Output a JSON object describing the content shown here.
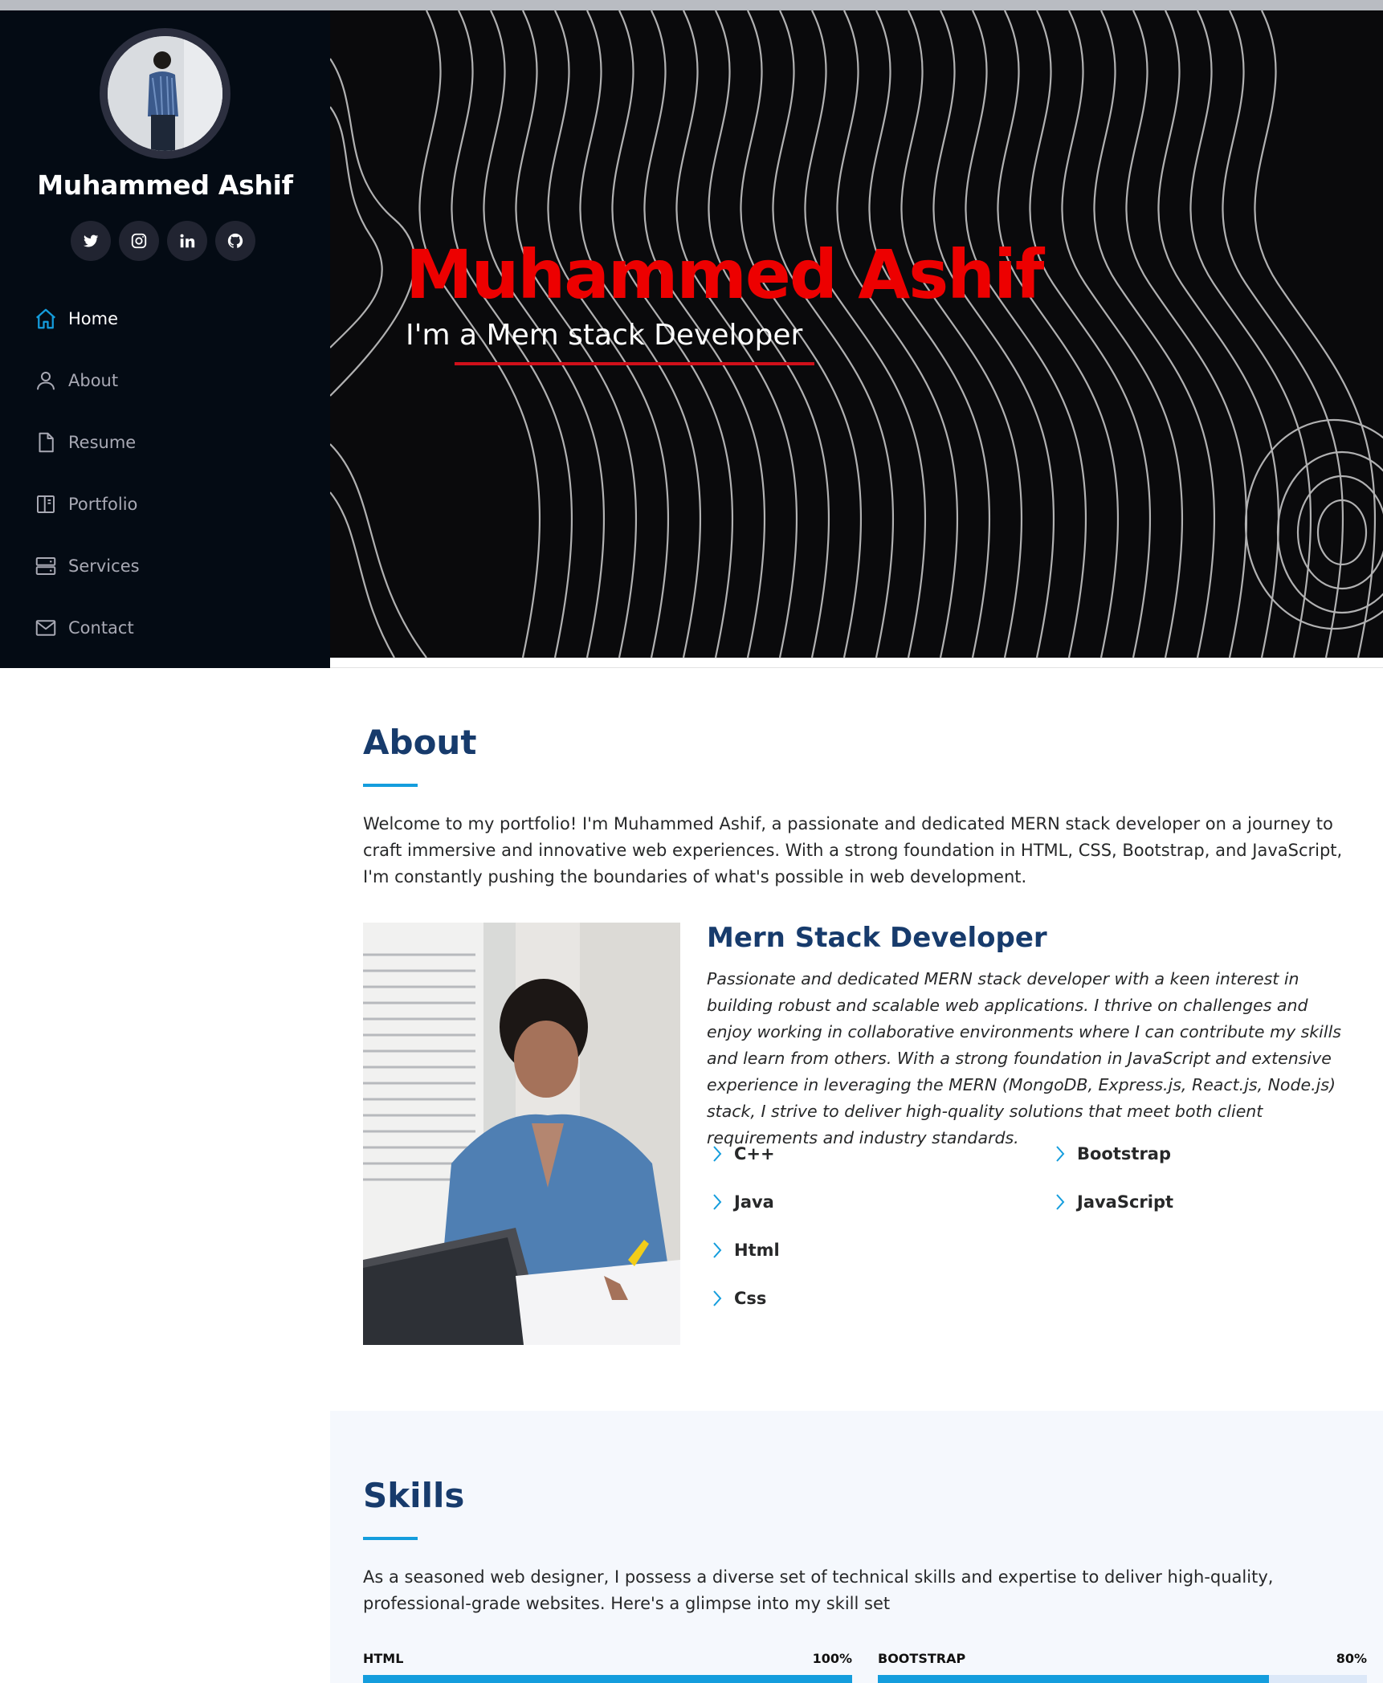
{
  "sidebar": {
    "name": "Muhammed Ashif",
    "social": [
      "twitter-icon",
      "instagram-icon",
      "linkedin-icon",
      "github-icon"
    ],
    "nav": [
      {
        "label": "Home",
        "icon": "home-icon",
        "active": true
      },
      {
        "label": "About",
        "icon": "user-icon"
      },
      {
        "label": "Resume",
        "icon": "file-icon"
      },
      {
        "label": "Portfolio",
        "icon": "book-icon"
      },
      {
        "label": "Services",
        "icon": "server-icon"
      },
      {
        "label": "Contact",
        "icon": "envelope-icon"
      }
    ]
  },
  "hero": {
    "title": "Muhammed Ashif",
    "subtitle": "I'm a Mern stack Developer"
  },
  "about": {
    "title": "About",
    "intro": "Welcome to my portfolio! I'm Muhammed Ashif, a passionate and dedicated MERN stack developer on a journey to craft immersive and innovative web experiences. With a strong foundation in HTML, CSS, Bootstrap, and JavaScript, I'm constantly pushing the boundaries of what's possible in web development.",
    "role": "Mern Stack Developer",
    "description": "Passionate and dedicated MERN stack developer with a keen interest in building robust and scalable web applications. I thrive on challenges and enjoy working in collaborative environments where I can contribute my skills and learn from others. With a strong foundation in JavaScript and extensive experience in leveraging the MERN (MongoDB, Express.js, React.js, Node.js) stack, I strive to deliver high-quality solutions that meet both client requirements and industry standards.",
    "skills_left": [
      "C++",
      "Java",
      "Html",
      "Css"
    ],
    "skills_right": [
      "Bootstrap",
      "JavaScript"
    ]
  },
  "skills": {
    "title": "Skills",
    "intro": "As a seasoned web designer, I possess a diverse set of technical skills and expertise to deliver high-quality, professional-grade websites. Here's a glimpse into my skill set",
    "bars": [
      {
        "label": "HTML",
        "value_text": "100%",
        "value": 100
      },
      {
        "label": "BOOTSTRAP",
        "value_text": "80%",
        "value": 80
      }
    ]
  },
  "colors": {
    "sidebar_bg": "#040b14",
    "accent": "#149ddd",
    "heading": "#173b6c",
    "hero_title": "#ed0000",
    "skills_bg": "#f5f8fd"
  }
}
